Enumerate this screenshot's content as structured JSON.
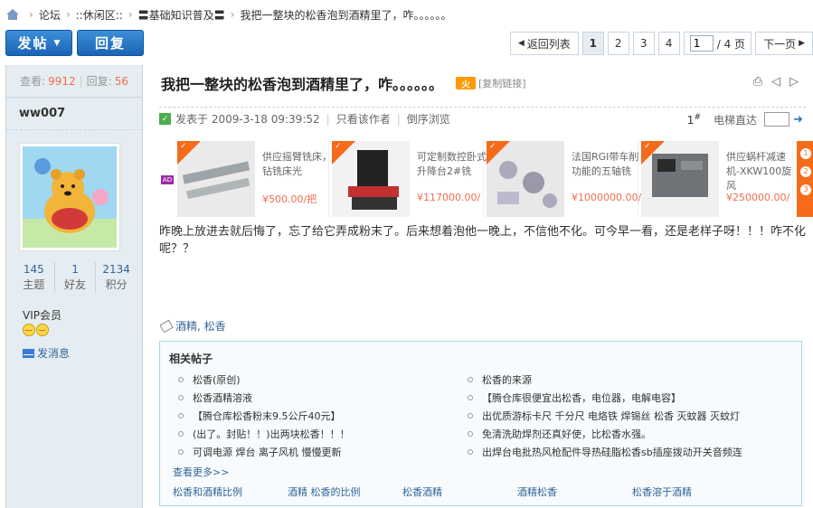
{
  "breadcrumb": {
    "items": [
      "论坛",
      "::休闲区::",
      "〓基础知识普及〓",
      "我把一整块的松香泡到酒精里了，咋。。。。。。"
    ]
  },
  "toolbar": {
    "post_label": "发帖",
    "reply_label": "回复"
  },
  "pager": {
    "back_label": "返回列表",
    "pages": [
      "1",
      "2",
      "3",
      "4"
    ],
    "current_page": "1",
    "page_input_value": "1",
    "total_label": "/ 4 页",
    "next_label": "下一页"
  },
  "sidebar": {
    "views_label": "查看:",
    "views_value": "9912",
    "replies_label": "回复:",
    "replies_value": "56",
    "username": "ww007",
    "counts": [
      {
        "value": "145",
        "label": "主题"
      },
      {
        "value": "1",
        "label": "好友"
      },
      {
        "value": "2134",
        "label": "积分"
      }
    ],
    "vip_label": "VIP会员",
    "message_label": "发消息"
  },
  "thread": {
    "title": "我把一整块的松香泡到酒精里了，咋。。。。。。",
    "copy_link_label": "[复制链接]",
    "posted_label": "发表于 2009-3-18 09:39:52",
    "author_only_label": "只看该作者",
    "reverse_label": "倒序浏览",
    "floor_number": "1",
    "floor_suffix": "#",
    "jump_label": "电梯直达",
    "body": "昨晚上放进去就后悔了，忘了给它弄成粉末了。后来想着泡他一晚上，不信他不化。可今早一看，还是老样子呀！！！咋不化呢？？",
    "tags": "酒精, 松香"
  },
  "ads": [
    {
      "text": "供应摇臂铣床，钻铣床光",
      "price": "¥500.00/把"
    },
    {
      "text": "可定制数控卧式升降台2#铣",
      "price": "¥117000.00/"
    },
    {
      "text": "法国RGI带车削功能的五轴铣",
      "price": "¥1000000.00/"
    },
    {
      "text": "供应蜗杆减速机-XKW100旋风",
      "price": "¥250000.00/"
    }
  ],
  "ad_badge": "AD",
  "ad_edge_numbers": [
    "1",
    "2",
    "3"
  ],
  "related": {
    "title": "相关帖子",
    "left": [
      "松香(原创)",
      "松香酒精溶液",
      "【腾仓库松香粉末9.5公斤40元】",
      "(出了。封贴！！)出两块松香！！！",
      "可调电源 焊台 离子风机 慢慢更新"
    ],
    "right": [
      "松香的来源",
      "【腾仓库很便宜出松香，电位器，电解电容】",
      "出优质游标卡尺 千分尺 电烙铁 焊锡丝 松香 灭蚊器 灭蚊灯",
      "免清洗助焊剂还真好使，比松香水强。",
      "出焊台电批热风枪配件导热硅脂松香sb插座拨动开关音频连"
    ],
    "more_label": "查看更多>>",
    "keywords": [
      "松香和酒精比例",
      "酒精 松香的比例",
      "松香酒精",
      "酒精松香",
      "松香溶于酒精"
    ]
  }
}
